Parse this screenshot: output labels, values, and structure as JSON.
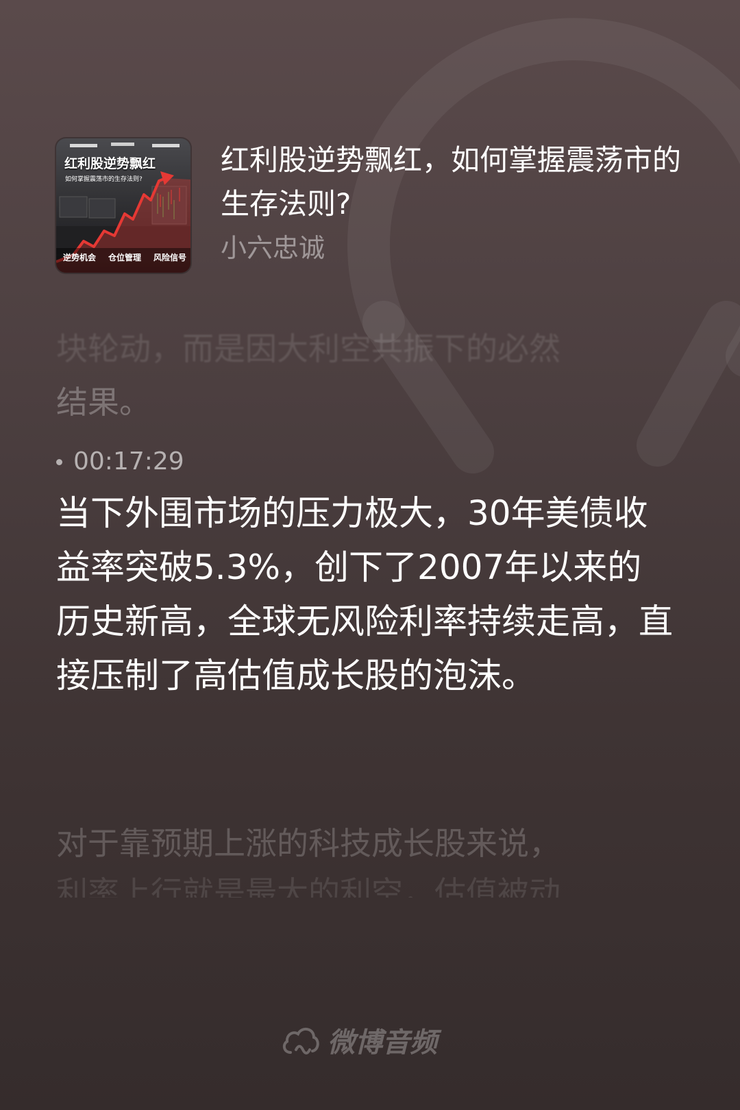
{
  "podcast": {
    "title": "红利股逆势飘红，如何掌握震荡市的生存法则?",
    "author": "小六忠诚",
    "cover": {
      "headline": "红利股逆势飘红",
      "subheadline": "如何掌握震荡市的生存法则?",
      "tags": [
        "逆势机会",
        "仓位管理",
        "风险信号"
      ]
    }
  },
  "transcript": {
    "previous_partial": "块轮动，而是因大利空共振下的必然",
    "previous_end": "结果。",
    "timestamp": "00:17:29",
    "active_paragraph": "当下外围市场的压力极大，30年美债收益率突破5.3%，创下了2007年以来的历史新高，全球无风险利率持续走高，直接压制了高估值成长股的泡沫。",
    "next_line1": "对于靠预期上涨的科技成长股来说，",
    "next_line2": "利率上行就是最大的利空，估值被动"
  },
  "brand": {
    "name": "微博音频",
    "icon": "cloud-wave-icon"
  },
  "colors": {
    "bg_top": "#5a4a4b",
    "bg_bottom": "#352c2c",
    "cover_accent": "#e53935"
  }
}
